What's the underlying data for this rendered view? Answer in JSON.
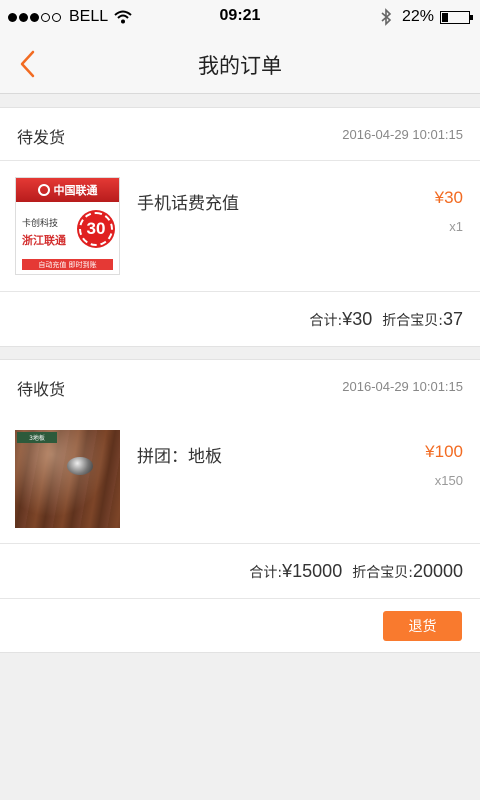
{
  "status_bar": {
    "carrier": "BELL",
    "time": "09:21",
    "battery_percent": "22%",
    "battery_level": 0.22,
    "signal_bars_filled": 3,
    "signal_bars_total": 5
  },
  "header": {
    "title": "我的订单",
    "back_icon": "chevron-left-icon",
    "accent_color": "#f26b22"
  },
  "orders": [
    {
      "status": "待发货",
      "time": "2016-04-29 10:01:15",
      "item": {
        "name": "手机话费充值",
        "price": "¥30",
        "qty": "x1",
        "image": {
          "brand": "中国联通",
          "line1": "卡创科技",
          "line2": "浙江联通",
          "amount": "30",
          "strip": "自动充值 即时到账"
        }
      },
      "total_label": "合计:",
      "total_value": "¥30",
      "points_label": "折合宝贝:",
      "points_value": "37"
    },
    {
      "status": "待收货",
      "time": "2016-04-29 10:01:15",
      "item": {
        "name": "拼团：地板",
        "price": "¥100",
        "qty": "x150",
        "image": {
          "logo": "3地板"
        }
      },
      "total_label": "合计:",
      "total_value": "¥15000",
      "points_label": "折合宝贝:",
      "points_value": "20000",
      "action_label": "退货"
    }
  ]
}
